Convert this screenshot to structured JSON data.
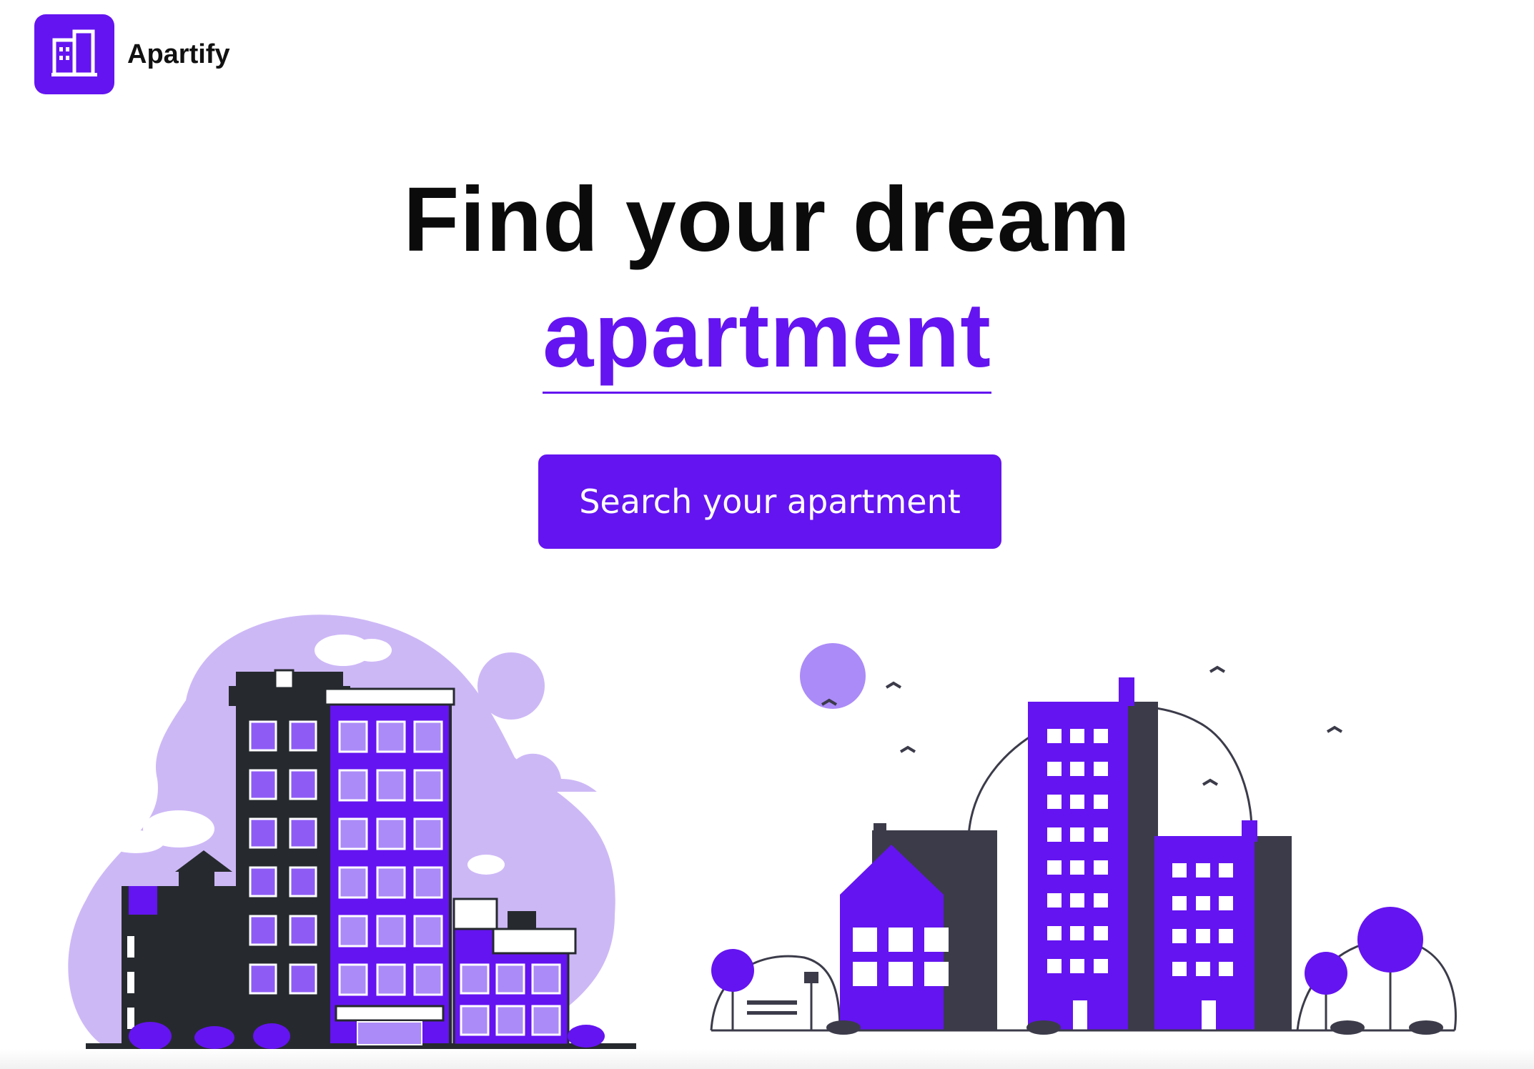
{
  "brand": {
    "name": "Apartify",
    "logo_icon": "building-icon",
    "color": "#6414f0"
  },
  "hero": {
    "title_line1": "Find your dream",
    "title_highlight": "apartment"
  },
  "cta": {
    "label": "Search your apartment"
  },
  "illustrations": {
    "left": "city-buildings-illustration",
    "right": "town-skyline-illustration"
  }
}
